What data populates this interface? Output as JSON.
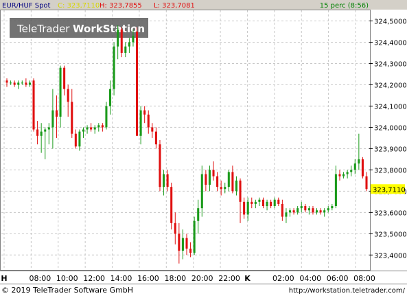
{
  "header": {
    "symbol": "EUR/HUF Spot",
    "close_label": "C: 323,7110",
    "high_label": "H: 323,7855",
    "low_label": "L: 323,7081",
    "interval": "15 perc (8:56)"
  },
  "watermark": {
    "brand": "TeleTrader",
    "product": "WorkStation"
  },
  "footer": {
    "copyright": "© 2019 TeleTrader Software GmbH",
    "url": "http://workstation.teletrader.com/"
  },
  "colors": {
    "up": "#1a9a1a",
    "down": "#e01010",
    "grid": "#c8c8c8",
    "header_bg": "#d4d0c8",
    "close_text": "#d6d600",
    "price_tag": "#ffff00"
  },
  "chart_data": {
    "type": "candlestick",
    "ylim": [
      323.33,
      324.55
    ],
    "y_ticks": [
      "324,5000",
      "324,4000",
      "324,3000",
      "324,2000",
      "324,1000",
      "324,0000",
      "323,9000",
      "323,8000",
      "323,7000",
      "323,6000",
      "323,5000",
      "323,4000"
    ],
    "x_ticks": [
      "H",
      "08:00",
      "10:00",
      "12:00",
      "14:00",
      "16:00",
      "18:00",
      "20:00",
      "22:00",
      "K",
      "02:00",
      "04:00",
      "06:00",
      "08:00"
    ],
    "last_price_label": "323,7110",
    "candles": [
      {
        "o": 324.22,
        "h": 324.23,
        "l": 324.19,
        "c": 324.21
      },
      {
        "o": 324.21,
        "h": 324.22,
        "l": 324.2,
        "c": 324.21
      },
      {
        "o": 324.21,
        "h": 324.22,
        "l": 324.19,
        "c": 324.2
      },
      {
        "o": 324.2,
        "h": 324.22,
        "l": 324.18,
        "c": 324.21
      },
      {
        "o": 324.21,
        "h": 324.22,
        "l": 324.2,
        "c": 324.21
      },
      {
        "o": 324.21,
        "h": 324.23,
        "l": 324.19,
        "c": 324.2
      },
      {
        "o": 324.2,
        "h": 324.22,
        "l": 324.19,
        "c": 324.21
      },
      {
        "o": 324.22,
        "h": 324.23,
        "l": 323.98,
        "c": 323.99
      },
      {
        "o": 323.99,
        "h": 324.03,
        "l": 323.92,
        "c": 323.96
      },
      {
        "o": 323.96,
        "h": 324.02,
        "l": 323.88,
        "c": 323.98
      },
      {
        "o": 323.98,
        "h": 324.0,
        "l": 323.85,
        "c": 323.99
      },
      {
        "o": 323.99,
        "h": 324.02,
        "l": 323.92,
        "c": 324.0
      },
      {
        "o": 324.0,
        "h": 324.18,
        "l": 323.9,
        "c": 324.08
      },
      {
        "o": 324.08,
        "h": 324.15,
        "l": 323.95,
        "c": 324.05
      },
      {
        "o": 324.05,
        "h": 324.29,
        "l": 324.0,
        "c": 324.28
      },
      {
        "o": 324.28,
        "h": 324.29,
        "l": 324.15,
        "c": 324.18
      },
      {
        "o": 324.18,
        "h": 324.2,
        "l": 324.05,
        "c": 324.12
      },
      {
        "o": 324.12,
        "h": 324.18,
        "l": 323.95,
        "c": 323.97
      },
      {
        "o": 323.97,
        "h": 323.99,
        "l": 323.9,
        "c": 323.91
      },
      {
        "o": 323.91,
        "h": 323.99,
        "l": 323.89,
        "c": 323.98
      },
      {
        "o": 323.98,
        "h": 324.0,
        "l": 323.95,
        "c": 323.99
      },
      {
        "o": 323.99,
        "h": 324.01,
        "l": 323.97,
        "c": 324.0
      },
      {
        "o": 324.0,
        "h": 324.02,
        "l": 323.98,
        "c": 323.99
      },
      {
        "o": 323.99,
        "h": 324.01,
        "l": 323.97,
        "c": 324.0
      },
      {
        "o": 324.0,
        "h": 324.02,
        "l": 323.98,
        "c": 324.01
      },
      {
        "o": 324.01,
        "h": 324.02,
        "l": 323.98,
        "c": 324.0
      },
      {
        "o": 324.0,
        "h": 324.12,
        "l": 323.99,
        "c": 324.1
      },
      {
        "o": 324.1,
        "h": 324.22,
        "l": 324.06,
        "c": 324.18
      },
      {
        "o": 324.18,
        "h": 324.4,
        "l": 324.15,
        "c": 324.38
      },
      {
        "o": 324.38,
        "h": 324.48,
        "l": 324.32,
        "c": 324.46
      },
      {
        "o": 324.46,
        "h": 324.47,
        "l": 324.33,
        "c": 324.35
      },
      {
        "o": 324.35,
        "h": 324.4,
        "l": 324.33,
        "c": 324.38
      },
      {
        "o": 324.38,
        "h": 324.42,
        "l": 324.35,
        "c": 324.4
      },
      {
        "o": 324.4,
        "h": 324.46,
        "l": 324.38,
        "c": 324.43
      },
      {
        "o": 324.45,
        "h": 324.47,
        "l": 324.02,
        "c": 323.96
      },
      {
        "o": 323.96,
        "h": 324.1,
        "l": 323.92,
        "c": 324.08
      },
      {
        "o": 324.08,
        "h": 324.1,
        "l": 324.02,
        "c": 324.06
      },
      {
        "o": 324.06,
        "h": 324.08,
        "l": 323.97,
        "c": 324.0
      },
      {
        "o": 324.0,
        "h": 324.02,
        "l": 323.95,
        "c": 323.98
      },
      {
        "o": 323.98,
        "h": 324.0,
        "l": 323.9,
        "c": 323.92
      },
      {
        "o": 323.92,
        "h": 323.94,
        "l": 323.7,
        "c": 323.72
      },
      {
        "o": 323.72,
        "h": 323.8,
        "l": 323.68,
        "c": 323.78
      },
      {
        "o": 323.78,
        "h": 323.8,
        "l": 323.7,
        "c": 323.72
      },
      {
        "o": 323.72,
        "h": 323.74,
        "l": 323.52,
        "c": 323.55
      },
      {
        "o": 323.55,
        "h": 323.6,
        "l": 323.45,
        "c": 323.5
      },
      {
        "o": 323.5,
        "h": 323.55,
        "l": 323.36,
        "c": 323.42
      },
      {
        "o": 323.42,
        "h": 323.52,
        "l": 323.38,
        "c": 323.48
      },
      {
        "o": 323.48,
        "h": 323.5,
        "l": 323.4,
        "c": 323.43
      },
      {
        "o": 323.43,
        "h": 323.46,
        "l": 323.39,
        "c": 323.41
      },
      {
        "o": 323.41,
        "h": 323.58,
        "l": 323.4,
        "c": 323.56
      },
      {
        "o": 323.56,
        "h": 323.66,
        "l": 323.5,
        "c": 323.62
      },
      {
        "o": 323.62,
        "h": 323.82,
        "l": 323.58,
        "c": 323.78
      },
      {
        "o": 323.78,
        "h": 323.8,
        "l": 323.7,
        "c": 323.73
      },
      {
        "o": 323.73,
        "h": 323.82,
        "l": 323.7,
        "c": 323.8
      },
      {
        "o": 323.8,
        "h": 323.84,
        "l": 323.75,
        "c": 323.77
      },
      {
        "o": 323.77,
        "h": 323.79,
        "l": 323.7,
        "c": 323.72
      },
      {
        "o": 323.72,
        "h": 323.75,
        "l": 323.68,
        "c": 323.71
      },
      {
        "o": 323.71,
        "h": 323.74,
        "l": 323.69,
        "c": 323.72
      },
      {
        "o": 323.72,
        "h": 323.8,
        "l": 323.7,
        "c": 323.79
      },
      {
        "o": 323.79,
        "h": 323.82,
        "l": 323.69,
        "c": 323.7
      },
      {
        "o": 323.7,
        "h": 323.77,
        "l": 323.68,
        "c": 323.75
      },
      {
        "o": 323.75,
        "h": 323.76,
        "l": 323.55,
        "c": 323.65
      },
      {
        "o": 323.65,
        "h": 323.67,
        "l": 323.57,
        "c": 323.59
      },
      {
        "o": 323.59,
        "h": 323.67,
        "l": 323.56,
        "c": 323.65
      },
      {
        "o": 323.65,
        "h": 323.67,
        "l": 323.62,
        "c": 323.64
      },
      {
        "o": 323.64,
        "h": 323.66,
        "l": 323.62,
        "c": 323.65
      },
      {
        "o": 323.65,
        "h": 323.67,
        "l": 323.63,
        "c": 323.66
      },
      {
        "o": 323.66,
        "h": 323.67,
        "l": 323.62,
        "c": 323.63
      },
      {
        "o": 323.63,
        "h": 323.66,
        "l": 323.61,
        "c": 323.65
      },
      {
        "o": 323.65,
        "h": 323.66,
        "l": 323.62,
        "c": 323.63
      },
      {
        "o": 323.63,
        "h": 323.67,
        "l": 323.62,
        "c": 323.66
      },
      {
        "o": 323.66,
        "h": 323.67,
        "l": 323.63,
        "c": 323.64
      },
      {
        "o": 323.64,
        "h": 323.66,
        "l": 323.56,
        "c": 323.58
      },
      {
        "o": 323.58,
        "h": 323.62,
        "l": 323.55,
        "c": 323.6
      },
      {
        "o": 323.6,
        "h": 323.62,
        "l": 323.58,
        "c": 323.61
      },
      {
        "o": 323.61,
        "h": 323.62,
        "l": 323.59,
        "c": 323.6
      },
      {
        "o": 323.6,
        "h": 323.63,
        "l": 323.59,
        "c": 323.62
      },
      {
        "o": 323.62,
        "h": 323.65,
        "l": 323.6,
        "c": 323.63
      },
      {
        "o": 323.63,
        "h": 323.64,
        "l": 323.6,
        "c": 323.61
      },
      {
        "o": 323.61,
        "h": 323.63,
        "l": 323.59,
        "c": 323.62
      },
      {
        "o": 323.62,
        "h": 323.63,
        "l": 323.59,
        "c": 323.6
      },
      {
        "o": 323.6,
        "h": 323.62,
        "l": 323.59,
        "c": 323.61
      },
      {
        "o": 323.61,
        "h": 323.62,
        "l": 323.59,
        "c": 323.6
      },
      {
        "o": 323.6,
        "h": 323.62,
        "l": 323.58,
        "c": 323.61
      },
      {
        "o": 323.61,
        "h": 323.63,
        "l": 323.6,
        "c": 323.62
      },
      {
        "o": 323.62,
        "h": 323.64,
        "l": 323.61,
        "c": 323.63
      },
      {
        "o": 323.63,
        "h": 323.82,
        "l": 323.62,
        "c": 323.78
      },
      {
        "o": 323.78,
        "h": 323.8,
        "l": 323.75,
        "c": 323.77
      },
      {
        "o": 323.77,
        "h": 323.79,
        "l": 323.76,
        "c": 323.78
      },
      {
        "o": 323.78,
        "h": 323.8,
        "l": 323.76,
        "c": 323.79
      },
      {
        "o": 323.79,
        "h": 323.82,
        "l": 323.77,
        "c": 323.8
      },
      {
        "o": 323.8,
        "h": 323.85,
        "l": 323.78,
        "c": 323.83
      },
      {
        "o": 323.83,
        "h": 323.97,
        "l": 323.8,
        "c": 323.85
      },
      {
        "o": 323.85,
        "h": 323.86,
        "l": 323.76,
        "c": 323.77
      },
      {
        "o": 323.77,
        "h": 323.79,
        "l": 323.7,
        "c": 323.71
      }
    ]
  }
}
